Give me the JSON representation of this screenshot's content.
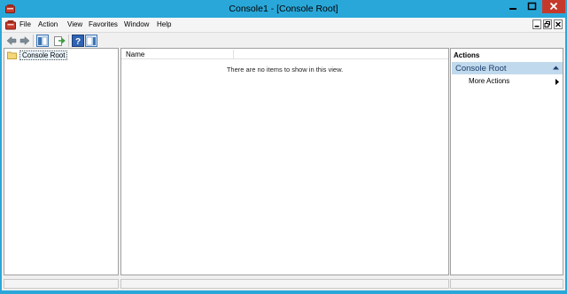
{
  "window": {
    "title": "Console1 - [Console Root]"
  },
  "menu": {
    "items": [
      "File",
      "Action",
      "View",
      "Favorites",
      "Window",
      "Help"
    ]
  },
  "toolbar": {
    "buttons": [
      "back-arrow-icon",
      "forward-arrow-icon",
      "show-hide-tree-icon",
      "export-list-icon",
      "help-icon",
      "show-hide-action-pane-icon"
    ]
  },
  "tree": {
    "items": [
      {
        "label": "Console Root",
        "icon": "folder-icon"
      }
    ]
  },
  "list": {
    "column_header": "Name",
    "empty_message": "There are no items to show in this view."
  },
  "actions": {
    "title": "Actions",
    "group": "Console Root",
    "entries": [
      "More Actions"
    ]
  },
  "colors": {
    "chrome": "#2aa7d9",
    "close_button": "#c5392b",
    "actions_group_bg": "#c0d9ec",
    "actions_group_text": "#1a3d6b"
  }
}
